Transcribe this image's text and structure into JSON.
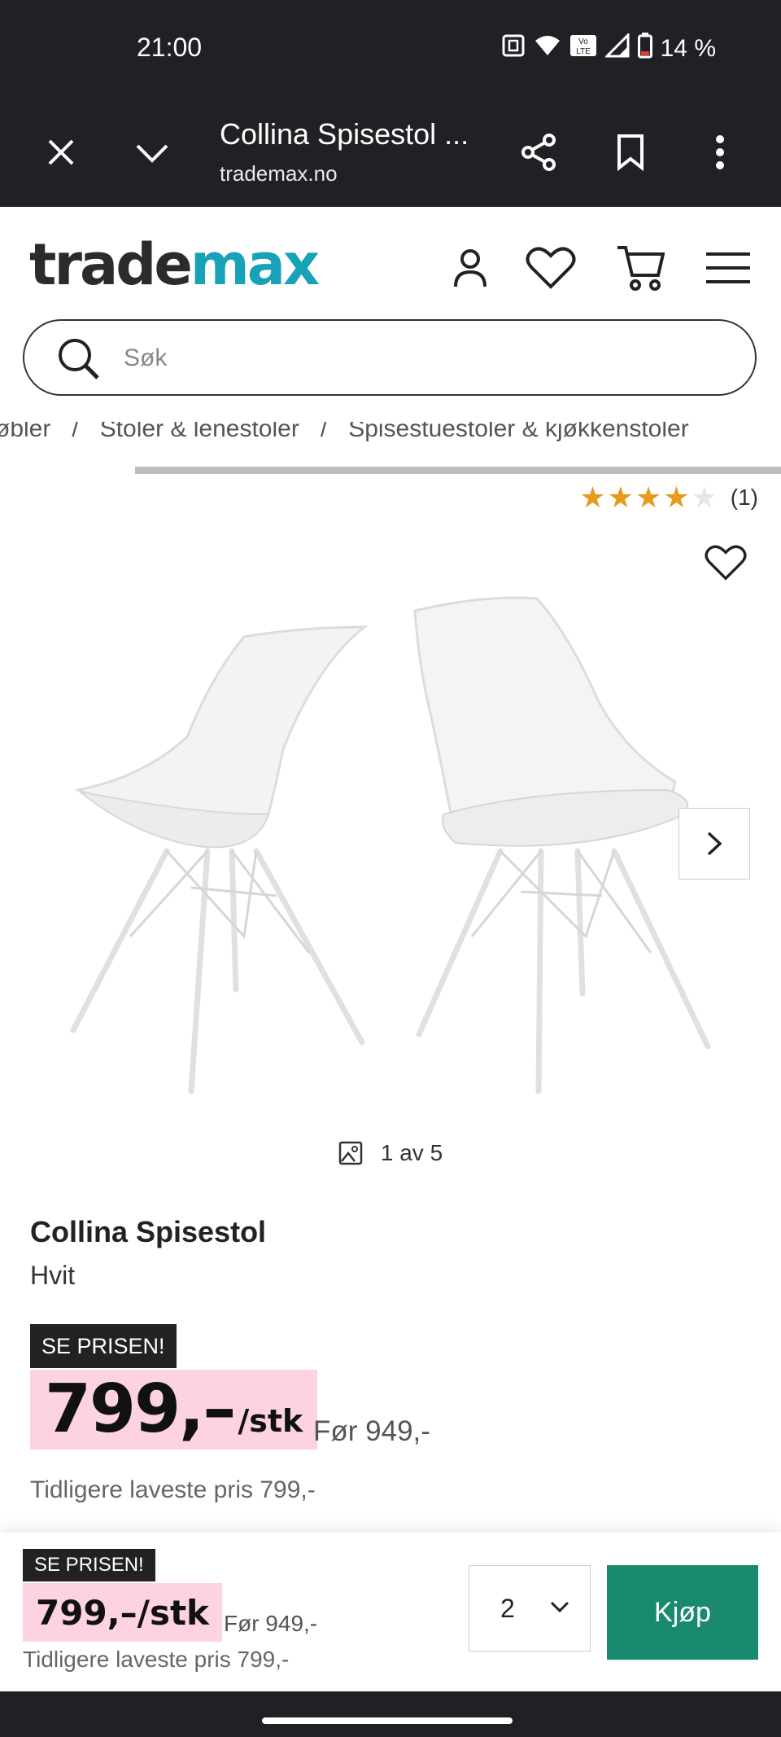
{
  "status_bar": {
    "time": "21:00",
    "battery": "14 %"
  },
  "browser": {
    "title": "Collina Spisestol ...",
    "url": "trademax.no"
  },
  "site": {
    "logo_left": "trade",
    "logo_right": "max"
  },
  "search": {
    "placeholder": "Søk"
  },
  "breadcrumb": {
    "items": [
      "øbler",
      "Stoler & lenestoler",
      "Spisestuestoler & kjøkkenstoler"
    ]
  },
  "rating": {
    "stars": 4,
    "max": 5,
    "count": "(1)"
  },
  "gallery": {
    "counter": "1 av 5"
  },
  "product": {
    "name": "Collina Spisestol",
    "color": "Hvit"
  },
  "price": {
    "badge": "SE PRISEN!",
    "amount": "799,–",
    "unit": "/stk",
    "before": "Før 949,-",
    "lowest": "Tidligere laveste pris 799,-"
  },
  "sticky": {
    "badge": "SE PRISEN!",
    "price": "799,–/stk",
    "before": "Før 949,-",
    "lowest": "Tidligere laveste pris 799,-",
    "quantity": "2",
    "buy_label": "Kjøp"
  },
  "colors": {
    "accent": "#17a2b8",
    "buy": "#1a8a6e",
    "price_bg": "#fdd3e1",
    "star": "#e69a1e"
  }
}
